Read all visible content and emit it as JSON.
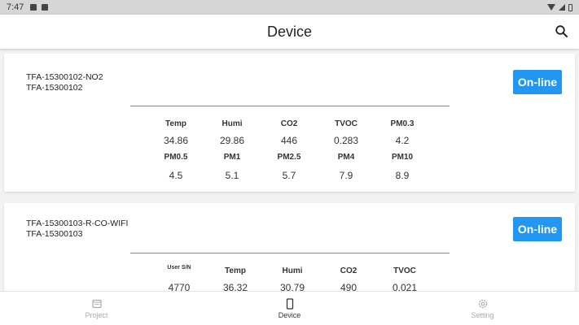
{
  "status_bar": {
    "time": "7:47"
  },
  "app_bar": {
    "title": "Device"
  },
  "devices": [
    {
      "name_line1": "TFA-15300102-NO2",
      "name_line2": "TFA-15300102",
      "status": "On-line",
      "row1_labels": [
        "Temp",
        "Humi",
        "CO2",
        "TVOC",
        "PM0.3"
      ],
      "row1_values": [
        "34.86",
        "29.86",
        "446",
        "0.283",
        "4.2"
      ],
      "row2_labels": [
        "PM0.5",
        "PM1",
        "PM2.5",
        "PM4",
        "PM10"
      ],
      "row2_values": [
        "4.5",
        "5.1",
        "5.7",
        "7.9",
        "8.9"
      ]
    },
    {
      "name_line1": "TFA-15300103-R-CO-WIFI",
      "name_line2": "TFA-15300103",
      "status": "On-line",
      "row1_labels": [
        "User S/N",
        "Temp",
        "Humi",
        "CO2",
        "TVOC"
      ],
      "row1_values": [
        "4770",
        "36.32",
        "30.79",
        "490",
        "0.021"
      ]
    }
  ],
  "bottom_nav": [
    {
      "label": "Project",
      "icon": "folder-icon",
      "active": false
    },
    {
      "label": "Device",
      "icon": "phone-icon",
      "active": true
    },
    {
      "label": "Setting",
      "icon": "gear-icon",
      "active": false
    }
  ],
  "colors": {
    "accent": "#2196f3"
  }
}
